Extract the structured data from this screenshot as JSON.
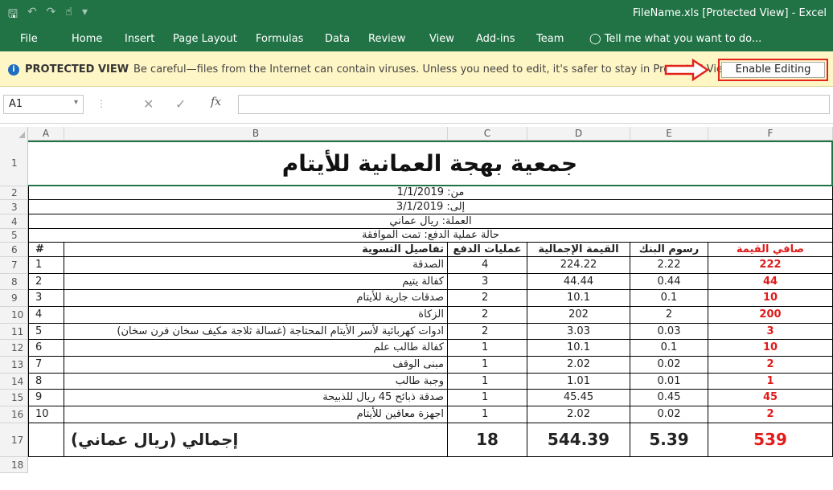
{
  "app": {
    "window_title": "FileName.xls  [Protected View] - Excel",
    "qat_icons": [
      "save-icon",
      "undo-icon",
      "redo-icon",
      "touch-mode-icon",
      "customize-qat-icon"
    ]
  },
  "menu": {
    "file": "File",
    "tabs": [
      "Home",
      "Insert",
      "Page Layout",
      "Formulas",
      "Data",
      "Review",
      "View",
      "Add-ins",
      "Team"
    ],
    "tell_me": "Tell me what you want to do..."
  },
  "protected_view": {
    "label": "PROTECTED VIEW",
    "message": "Be careful—files from the Internet can contain viruses. Unless you need to edit, it's safer to stay in Protected View.",
    "enable_button": "Enable Editing",
    "accent_color": "#e3241b"
  },
  "formula_bar": {
    "name_box": "A1",
    "fx_label": "fx",
    "formula": ""
  },
  "columns": [
    "A",
    "B",
    "C",
    "D",
    "E",
    "F"
  ],
  "rows": [
    "1",
    "2",
    "3",
    "4",
    "5",
    "6",
    "7",
    "8",
    "9",
    "10",
    "11",
    "12",
    "13",
    "14",
    "15",
    "16",
    "17",
    "18"
  ],
  "sheet": {
    "title": "جمعية بهجة العمانية للأيتام",
    "from": "من: 1/1/2019",
    "to": "إلى: 3/1/2019",
    "currency": "العملة: ريال عماني",
    "status": "حالة عملية الدفع: تمت الموافقة",
    "headers": {
      "num": "#",
      "details": "تفاصيل التسوية",
      "ops": "عمليات الدفع",
      "total": "القيمة الإجمالية",
      "fees": "رسوم البنك",
      "net": "صافي القيمة"
    },
    "items": [
      {
        "num": "1",
        "details": "الصدقة",
        "ops": "4",
        "total": "224.22",
        "fees": "2.22",
        "net": "222"
      },
      {
        "num": "2",
        "details": "كفالة يتيم",
        "ops": "3",
        "total": "44.44",
        "fees": "0.44",
        "net": "44"
      },
      {
        "num": "3",
        "details": "صدقات جارية للأيتام",
        "ops": "2",
        "total": "10.1",
        "fees": "0.1",
        "net": "10"
      },
      {
        "num": "4",
        "details": "الزكاة",
        "ops": "2",
        "total": "202",
        "fees": "2",
        "net": "200"
      },
      {
        "num": "5",
        "details": "ادوات كهربائية لأسر الأيتام المحتاجة (غسالة ثلاجة مكيف سخان فرن سخان)",
        "ops": "2",
        "total": "3.03",
        "fees": "0.03",
        "net": "3"
      },
      {
        "num": "6",
        "details": "كفالة طالب علم",
        "ops": "1",
        "total": "10.1",
        "fees": "0.1",
        "net": "10"
      },
      {
        "num": "7",
        "details": "مبنى الوقف",
        "ops": "1",
        "total": "2.02",
        "fees": "0.02",
        "net": "2"
      },
      {
        "num": "8",
        "details": "وجبة طالب",
        "ops": "1",
        "total": "1.01",
        "fees": "0.01",
        "net": "1"
      },
      {
        "num": "9",
        "details": "صدقة ذبائح 45 ريال للذبيحة",
        "ops": "1",
        "total": "45.45",
        "fees": "0.45",
        "net": "45"
      },
      {
        "num": "10",
        "details": "اجهزة معاقين للأيتام",
        "ops": "1",
        "total": "2.02",
        "fees": "0.02",
        "net": "2"
      }
    ],
    "totals": {
      "label": "إجمالي (ريال عماني)",
      "ops": "18",
      "total": "544.39",
      "fees": "5.39",
      "net": "539"
    }
  }
}
